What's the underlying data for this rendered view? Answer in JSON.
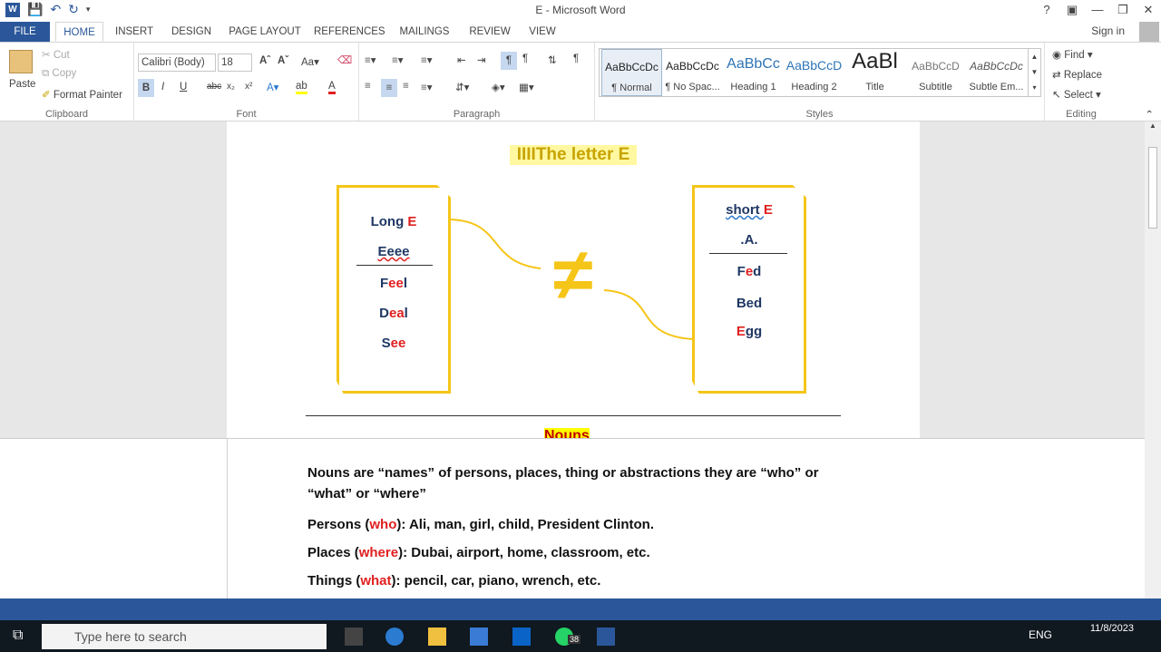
{
  "app": {
    "title": "E - Microsoft Word",
    "sign_in": "Sign in"
  },
  "tabs": [
    "FILE",
    "HOME",
    "INSERT",
    "DESIGN",
    "PAGE LAYOUT",
    "REFERENCES",
    "MAILINGS",
    "REVIEW",
    "VIEW"
  ],
  "clipboard": {
    "paste": "Paste",
    "cut": "Cut",
    "copy": "Copy",
    "format_painter": "Format Painter",
    "label": "Clipboard"
  },
  "font": {
    "name": "Calibri (Body)",
    "size": "18",
    "label": "Font"
  },
  "paragraph": {
    "label": "Paragraph"
  },
  "styles": {
    "label": "Styles",
    "items": [
      {
        "preview": "AaBbCcDc",
        "name": "¶ Normal"
      },
      {
        "preview": "AaBbCcDc",
        "name": "¶ No Spac..."
      },
      {
        "preview": "AaBbCc",
        "name": "Heading 1"
      },
      {
        "preview": "AaBbCcD",
        "name": "Heading 2"
      },
      {
        "preview": "AaBl",
        "name": "Title"
      },
      {
        "preview": "AaBbCcD",
        "name": "Subtitle"
      },
      {
        "preview": "AaBbCcDc",
        "name": "Subtle Em..."
      }
    ]
  },
  "editing": {
    "find": "Find",
    "replace": "Replace",
    "select": "Select",
    "label": "Editing"
  },
  "document": {
    "heading": "IIIIThe letter E",
    "long_box": {
      "title_a": "Long ",
      "title_b": "E",
      "sub": "Eeee",
      "w1a": "F",
      "w1b": "ee",
      "w1c": "l",
      "w2a": "D",
      "w2b": "ea",
      "w2c": "l",
      "w3a": "S",
      "w3b": "ee"
    },
    "short_box": {
      "title_a": "short ",
      "title_b": "E",
      "sub": ".A.",
      "w1a": "F",
      "w1b": "e",
      "w1c": "d",
      "w2": "Bed",
      "w3a": "E",
      "w3b": "gg"
    },
    "symbol": "≠",
    "nouns_heading": "Nouns",
    "nouns_def": "Nouns are “names” of persons, places, thing or abstractions they are “who” or “what” or “where”",
    "persons": {
      "a": "Persons (",
      "b": "who",
      "c": "): Ali, man, girl, child, President Clinton."
    },
    "places": {
      "a": "Places (",
      "b": "where",
      "c": "): Dubai, airport, home, classroom, etc."
    },
    "things": {
      "a": "Things (",
      "b": "what",
      "c": "): pencil, car, piano, wrench, etc."
    }
  },
  "taskbar": {
    "search_placeholder": "Type here to search",
    "lang": "ENG",
    "date": "11/8/2023",
    "badge": "38"
  },
  "colors": {
    "word_blue": "#2b579a",
    "box_yellow": "#f5c518",
    "text_navy": "#1f3864",
    "accent_red": "#e02020"
  }
}
